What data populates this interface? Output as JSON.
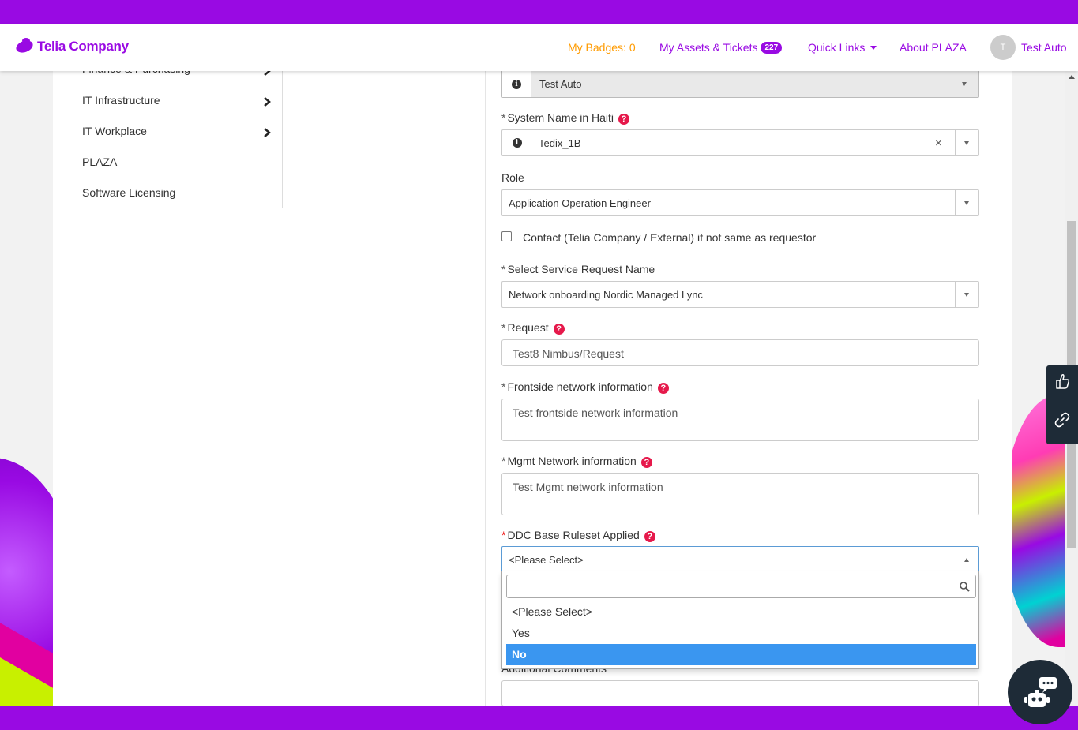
{
  "brand": {
    "logo_text": "Telia Company"
  },
  "header": {
    "badges": "My Badges: 0",
    "assets": "My Assets & Tickets",
    "assets_count": "227",
    "quick_links": "Quick Links",
    "about": "About PLAZA",
    "avatar_initial": "T",
    "user_name": "Test Auto"
  },
  "sidebar": {
    "items": [
      {
        "label": "Finance & Purchasing"
      },
      {
        "label": "IT Infrastructure"
      },
      {
        "label": "IT Workplace"
      },
      {
        "label": "PLAZA"
      },
      {
        "label": "Software Licensing"
      }
    ]
  },
  "form": {
    "requested_for_value": "Test Auto",
    "system_name_label": "System Name in Haiti",
    "system_name_value": "Tedix_1B",
    "role_label": "Role",
    "role_value": "Application Operation Engineer",
    "contact_label": "Contact (Telia Company / External) if not same as requestor",
    "service_request_label": "Select Service Request Name",
    "service_request_value": "Network onboarding Nordic Managed Lync",
    "request_label": "Request",
    "request_value": "Test8 Nimbus/Request",
    "frontside_label": "Frontside network information",
    "frontside_value": "Test frontside network information",
    "mgmt_label": "Mgmt Network information",
    "mgmt_value": "Test Mgmt network information",
    "ddc_label": "DDC Base Ruleset Applied",
    "ddc_value": "<Please Select>",
    "ddc_options": [
      "<Please Select>",
      "Yes",
      "No"
    ],
    "ddc_highlighted": "No",
    "additional_label": "Additional Comments",
    "required_mark": "*",
    "help_glyph": "?",
    "info_glyph": "i",
    "clear_glyph": "×"
  },
  "colors": {
    "brand_purple": "#990ae3",
    "badge_orange": "#ff9b00",
    "help_red": "#e6194b",
    "selected_option": "#3a96f0",
    "tools_dark": "#1e2b37"
  }
}
